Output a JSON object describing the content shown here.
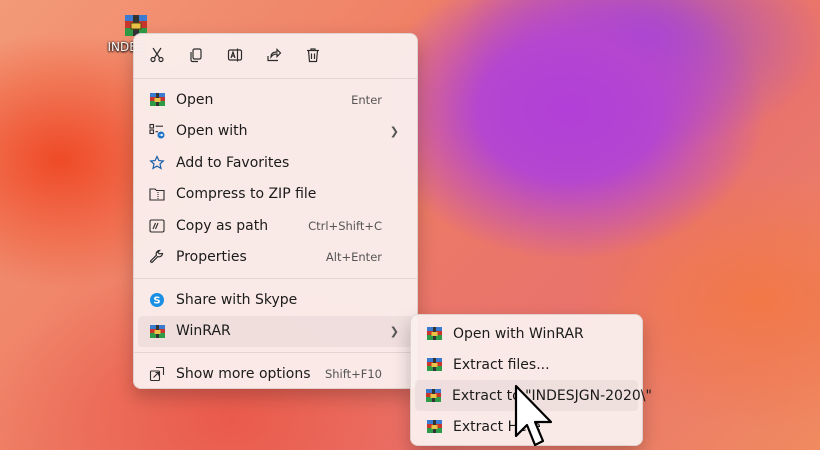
{
  "desktop": {
    "icon_label": "INDES"
  },
  "toolbar": {
    "cut_icon": "scissors-icon",
    "copy_icon": "copy-icon",
    "rename_icon": "rename-icon",
    "share_icon": "share-icon",
    "delete_icon": "trash-icon"
  },
  "menu": {
    "items": [
      {
        "label": "Open",
        "shortcut": "Enter",
        "icon": "winrar-icon"
      },
      {
        "label": "Open with",
        "shortcut": "",
        "icon": "open-with-icon"
      },
      {
        "label": "Add to Favorites",
        "shortcut": "",
        "icon": "star-icon"
      },
      {
        "label": "Compress to ZIP file",
        "shortcut": "",
        "icon": "zip-folder-icon"
      },
      {
        "label": "Copy as path",
        "shortcut": "Ctrl+Shift+C",
        "icon": "copy-path-icon"
      },
      {
        "label": "Properties",
        "shortcut": "Alt+Enter",
        "icon": "wrench-icon"
      },
      {
        "label": "Share with Skype",
        "shortcut": "",
        "icon": "skype-icon"
      },
      {
        "label": "WinRAR",
        "shortcut": "",
        "icon": "winrar-icon"
      },
      {
        "label": "Show more options",
        "shortcut": "Shift+F10",
        "icon": "more-options-icon"
      }
    ]
  },
  "submenu": {
    "items": [
      {
        "label": "Open with WinRAR",
        "icon": "winrar-icon"
      },
      {
        "label": "Extract files...",
        "icon": "winrar-icon"
      },
      {
        "label": "Extract to \"INDESJGN-2020\\\"",
        "icon": "winrar-icon"
      },
      {
        "label": "Extract Here",
        "icon": "winrar-icon"
      }
    ]
  },
  "colors": {
    "menu_bg": "#faeeec",
    "accent_blue": "#1a73c7"
  }
}
